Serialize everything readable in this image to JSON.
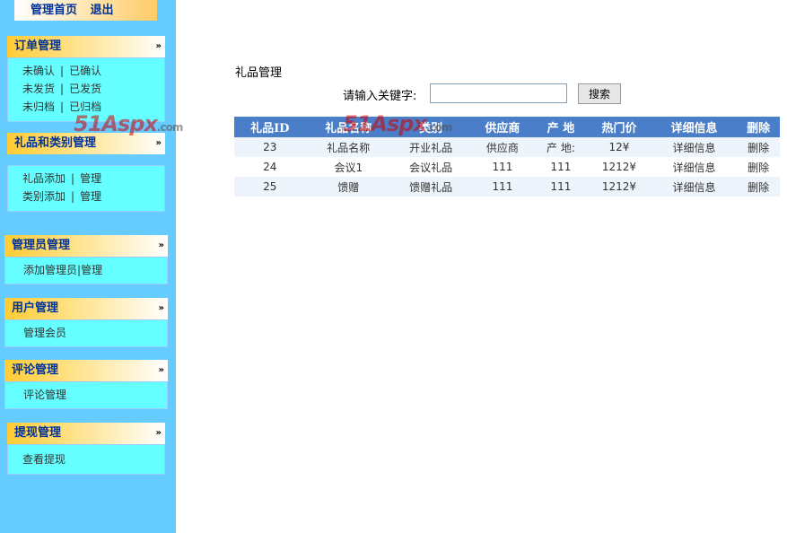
{
  "top": {
    "home": "管理首页",
    "logout": "退出"
  },
  "sidebar": {
    "panels": [
      {
        "title": "订单管理",
        "rows": [
          [
            "未确认",
            "已确认"
          ],
          [
            "未发货",
            "已发货"
          ],
          [
            "未归档",
            "已归档"
          ]
        ]
      },
      {
        "title": "礼品和类别管理",
        "rows": [
          [
            "礼品添加",
            "管理"
          ],
          [
            "类别添加",
            "管理"
          ]
        ]
      },
      {
        "title": "管理员管理",
        "rows": [
          [
            "添加管理员",
            "管理"
          ]
        ]
      },
      {
        "title": "用户管理",
        "rows": [
          [
            "管理会员"
          ]
        ]
      },
      {
        "title": "评论管理",
        "rows": [
          [
            "评论管理"
          ]
        ]
      },
      {
        "title": "提现管理",
        "rows": [
          [
            "查看提现"
          ]
        ]
      }
    ],
    "chevron": "»"
  },
  "main": {
    "title": "礼品管理",
    "search_label": "请输入关键字:",
    "search_value": "",
    "search_button": "搜索",
    "columns": [
      "礼品ID",
      "礼品名称",
      "类别",
      "供应商",
      "产 地",
      "热门价",
      "详细信息",
      "删除"
    ],
    "rows": [
      [
        "23",
        "礼品名称",
        "开业礼品",
        "供应商",
        "产 地:",
        "12¥",
        "详细信息",
        "删除"
      ],
      [
        "24",
        "会议1",
        "会议礼品",
        "111",
        "111",
        "1212¥",
        "详细信息",
        "删除"
      ],
      [
        "25",
        "馈赠",
        "馈赠礼品",
        "111",
        "111",
        "1212¥",
        "详细信息",
        "删除"
      ]
    ]
  },
  "watermark": {
    "text": "51Aspx",
    "suffix": ".com"
  }
}
